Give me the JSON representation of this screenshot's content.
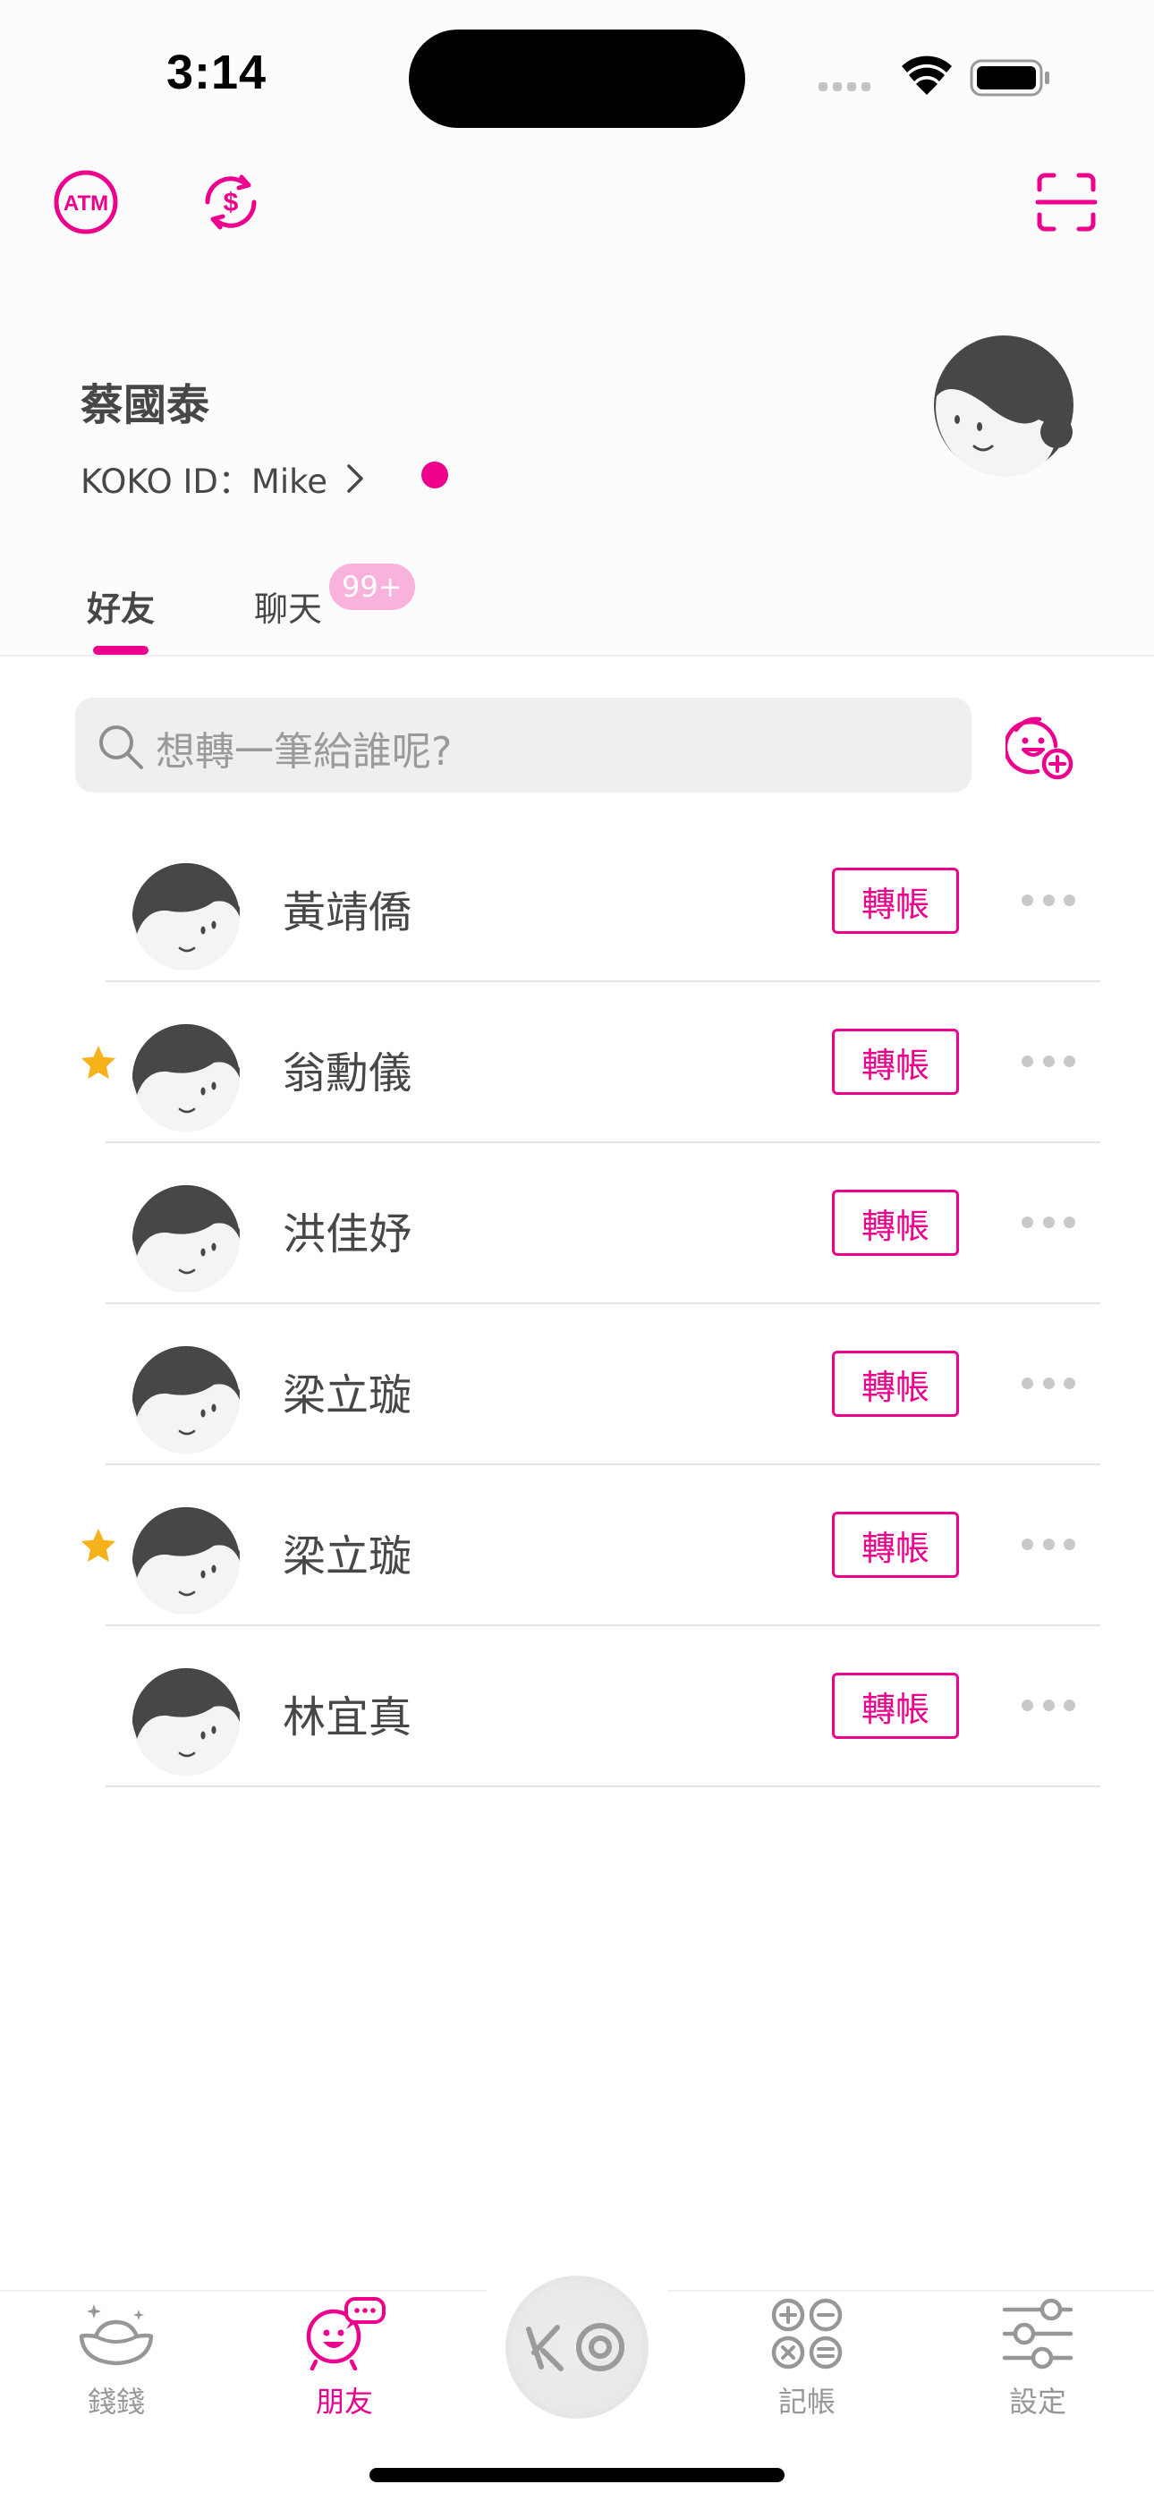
{
  "status_bar": {
    "time": "3:14"
  },
  "header": {
    "atm_label": "ATM"
  },
  "profile": {
    "name": "蔡國泰",
    "koko_id_label": "KOKO ID：Mike"
  },
  "tabs": [
    {
      "label": "好友",
      "active": true
    },
    {
      "label": "聊天",
      "badge": "99+"
    }
  ],
  "search": {
    "placeholder": "想轉一筆給誰呢?"
  },
  "friends": [
    {
      "name": "黃靖僑",
      "starred": false,
      "action": "轉帳"
    },
    {
      "name": "翁勳儀",
      "starred": true,
      "action": "轉帳"
    },
    {
      "name": "洪佳妤",
      "starred": false,
      "action": "轉帳"
    },
    {
      "name": "梁立璇",
      "starred": false,
      "action": "轉帳"
    },
    {
      "name": "梁立璇",
      "starred": true,
      "action": "轉帳"
    },
    {
      "name": "林宜真",
      "starred": false,
      "action": "轉帳"
    }
  ],
  "bottom_nav": [
    {
      "label": "錢錢",
      "icon": "money-ingot-icon"
    },
    {
      "label": "朋友",
      "icon": "friends-chat-icon",
      "active": true
    },
    {
      "label": "KO",
      "icon": "ko-center-icon"
    },
    {
      "label": "記帳",
      "icon": "calculator-icon"
    },
    {
      "label": "設定",
      "icon": "sliders-icon"
    }
  ],
  "colors": {
    "accent": "#ec008c",
    "star": "#f5b21b",
    "text": "#474747"
  }
}
